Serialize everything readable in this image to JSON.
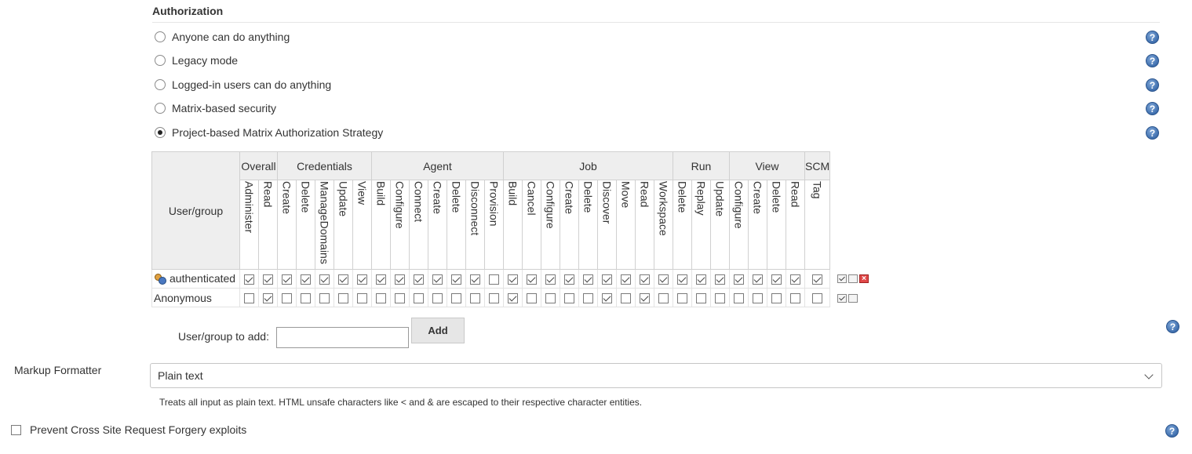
{
  "authorization": {
    "title": "Authorization",
    "options": [
      {
        "label": "Anyone can do anything",
        "selected": false
      },
      {
        "label": "Legacy mode",
        "selected": false
      },
      {
        "label": "Logged-in users can do anything",
        "selected": false
      },
      {
        "label": "Matrix-based security",
        "selected": false
      },
      {
        "label": "Project-based Matrix Authorization Strategy",
        "selected": true
      }
    ],
    "help_label": "?"
  },
  "matrix": {
    "user_group_header": "User/group",
    "groups": [
      {
        "name": "Overall",
        "permissions": [
          "Administer",
          "Read"
        ]
      },
      {
        "name": "Credentials",
        "permissions": [
          "Create",
          "Delete",
          "ManageDomains",
          "Update",
          "View"
        ]
      },
      {
        "name": "Agent",
        "permissions": [
          "Build",
          "Configure",
          "Connect",
          "Create",
          "Delete",
          "Disconnect",
          "Provision"
        ]
      },
      {
        "name": "Job",
        "permissions": [
          "Build",
          "Cancel",
          "Configure",
          "Create",
          "Delete",
          "Discover",
          "Move",
          "Read",
          "Workspace"
        ]
      },
      {
        "name": "Run",
        "permissions": [
          "Delete",
          "Replay",
          "Update"
        ]
      },
      {
        "name": "View",
        "permissions": [
          "Configure",
          "Create",
          "Delete",
          "Read"
        ]
      },
      {
        "name": "SCM",
        "permissions": [
          "Tag"
        ]
      }
    ],
    "rows": [
      {
        "name": "authenticated",
        "icon": "user-group-icon",
        "removable": true,
        "checks": [
          true,
          true,
          true,
          true,
          true,
          true,
          true,
          true,
          true,
          true,
          true,
          true,
          true,
          false,
          true,
          true,
          true,
          true,
          true,
          true,
          true,
          true,
          true,
          true,
          true,
          true,
          true,
          true,
          true,
          true,
          true
        ]
      },
      {
        "name": "Anonymous",
        "icon": "",
        "removable": false,
        "checks": [
          false,
          true,
          false,
          false,
          false,
          false,
          false,
          false,
          false,
          false,
          false,
          false,
          false,
          false,
          true,
          false,
          false,
          false,
          false,
          true,
          false,
          true,
          false,
          false,
          false,
          false,
          false,
          false,
          false,
          false,
          false
        ]
      }
    ]
  },
  "add_user": {
    "label": "User/group to add:",
    "value": "",
    "button": "Add"
  },
  "markup_formatter": {
    "label": "Markup Formatter",
    "selected": "Plain text",
    "description": "Treats all input as plain text. HTML unsafe characters like < and & are escaped to their respective character entities."
  },
  "csrf": {
    "label": "Prevent Cross Site Request Forgery exploits",
    "checked": false
  },
  "colors": {
    "help_blue": "#3f6fae",
    "header_gray": "#eeeeee",
    "remove_red": "#e04848"
  }
}
